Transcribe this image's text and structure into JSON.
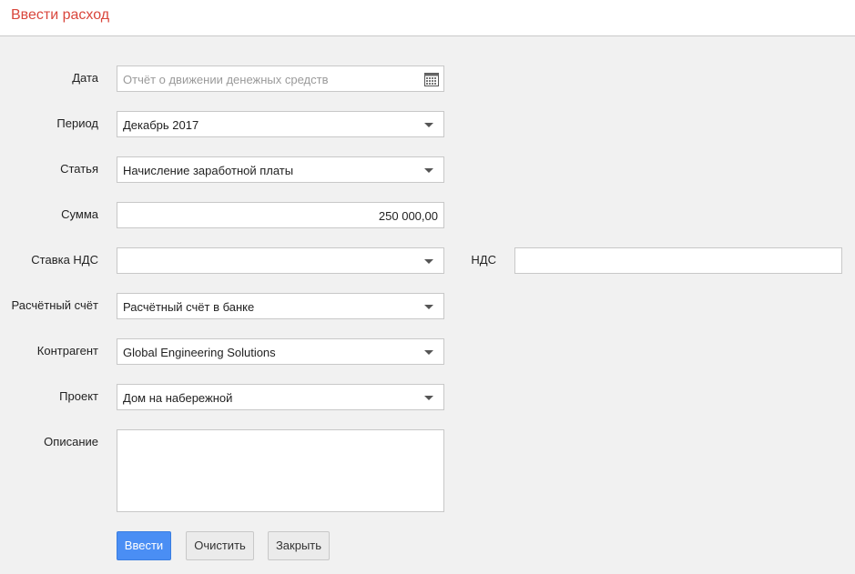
{
  "header": {
    "title": "Ввести расход"
  },
  "form": {
    "date": {
      "label": "Дата",
      "placeholder": "Отчёт о движении денежных средств"
    },
    "period": {
      "label": "Период",
      "value": "Декабрь 2017"
    },
    "article": {
      "label": "Статья",
      "value": "Начисление заработной платы"
    },
    "amount": {
      "label": "Сумма",
      "value": "250 000,00"
    },
    "vat_rate": {
      "label": "Ставка НДС",
      "value": ""
    },
    "vat": {
      "label": "НДС",
      "value": ""
    },
    "account": {
      "label": "Расчётный счёт",
      "value": "Расчётный счёт в банке"
    },
    "counterparty": {
      "label": "Контрагент",
      "value": "Global Engineering Solutions"
    },
    "project": {
      "label": "Проект",
      "value": "Дом на набережной"
    },
    "description": {
      "label": "Описание",
      "value": ""
    }
  },
  "buttons": {
    "submit": "Ввести",
    "clear": "Очистить",
    "close": "Закрыть"
  },
  "colors": {
    "title": "#d9463c",
    "primary_button": "#4a8ef4"
  },
  "icons": {
    "calendar": "calendar-icon",
    "dropdown": "chevron-down-icon"
  }
}
